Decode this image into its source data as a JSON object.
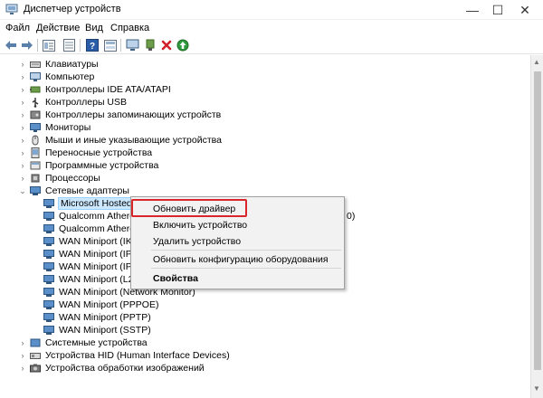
{
  "window": {
    "title": "Диспетчер устройств"
  },
  "menu": [
    "Файл",
    "Действие",
    "Вид",
    "Справка"
  ],
  "tree": {
    "categories_top": [
      "Клавиатуры",
      "Компьютер",
      "Контроллеры IDE ATA/ATAPI",
      "Контроллеры USB",
      "Контроллеры запоминающих устройств",
      "Мониторы",
      "Мыши и иные указывающие устройства",
      "Переносные устройства",
      "Программные устройства",
      "Процессоры"
    ],
    "network_category": "Сетевые адаптеры",
    "network_devices": [
      "Microsoft Hosted N",
      "Qualcomm Athero",
      "Qualcomm Athero",
      "WAN Miniport (IKE",
      "WAN Miniport (IP)",
      "WAN Miniport (IPv",
      "WAN Miniport (L2",
      "WAN Miniport (Network Monitor)",
      "WAN Miniport (PPPOE)",
      "WAN Miniport (PPTP)",
      "WAN Miniport (SSTP)"
    ],
    "qualcomm_suffix": "0)",
    "categories_bottom": [
      "Системные устройства",
      "Устройства HID (Human Interface Devices)",
      "Устройства обработки изображений"
    ]
  },
  "context_menu": {
    "update_driver": "Обновить драйвер",
    "enable_device": "Включить устройство",
    "uninstall_device": "Удалить устройство",
    "scan_hardware": "Обновить конфигурацию оборудования",
    "properties": "Свойства"
  },
  "colors": {
    "highlight_border": "#d9262b",
    "menu_bg": "#f2f2f2"
  }
}
